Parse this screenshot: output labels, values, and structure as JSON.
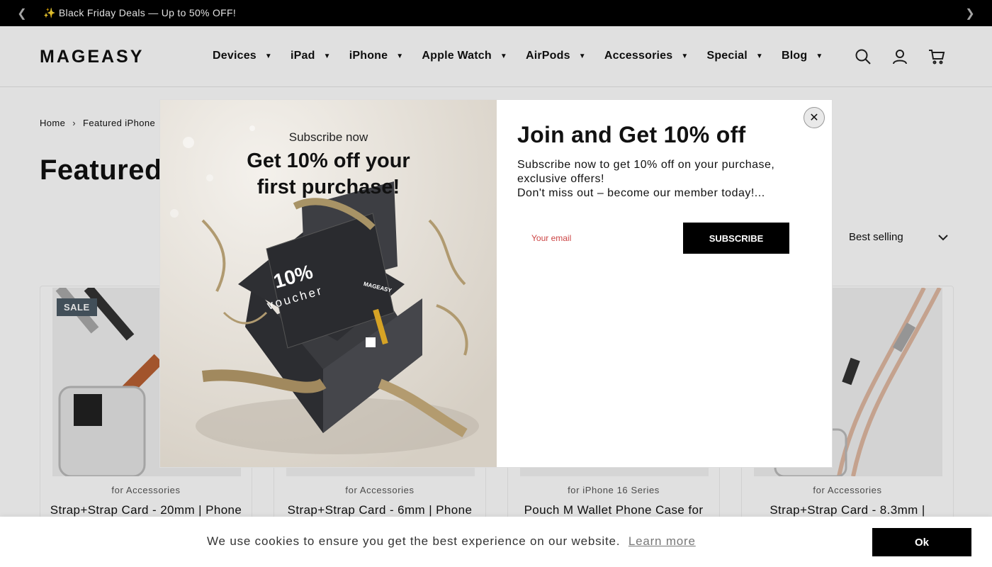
{
  "announcement": {
    "text": "✨ Black Friday Deals — Up to 50% OFF!"
  },
  "header": {
    "logo": "MAGEASY",
    "nav": [
      "Devices",
      "iPad",
      "iPhone",
      "Apple Watch",
      "AirPods",
      "Accessories",
      "Special",
      "Blog"
    ]
  },
  "breadcrumb": {
    "home": "Home",
    "current": "Featured iPhone"
  },
  "page": {
    "title": "Featured",
    "sort_value": "Best selling"
  },
  "products": [
    {
      "badge": "SALE",
      "category": "for Accessories",
      "title": "Strap+Strap Card - 20mm | Phone"
    },
    {
      "badge": "",
      "category": "for Accessories",
      "title": "Strap+Strap Card - 6mm | Phone"
    },
    {
      "badge": "",
      "category": "for iPhone 16 Series",
      "title": "Pouch M Wallet Phone Case for"
    },
    {
      "badge": "",
      "category": "for Accessories",
      "title": "Strap+Strap Card - 8.3mm |"
    }
  ],
  "modal": {
    "promo_sub": "Subscribe now",
    "promo_head_1": "Get 10% off your",
    "promo_head_2": "first purchase!",
    "voucher_big": "10%",
    "voucher_small": "voucher",
    "voucher_brand": "MAGEASY",
    "title": "Join and Get 10% off",
    "desc_1": "Subscribe now to get 10% off on your purchase, exclusive offers!",
    "desc_2": "Don't miss out – become our member today!...",
    "email_placeholder": "Your email",
    "subscribe_label": "SUBSCRIBE"
  },
  "cookie": {
    "message": "We use cookies to ensure you get the best experience on our website.",
    "link": "Learn more",
    "ok_label": "Ok"
  }
}
